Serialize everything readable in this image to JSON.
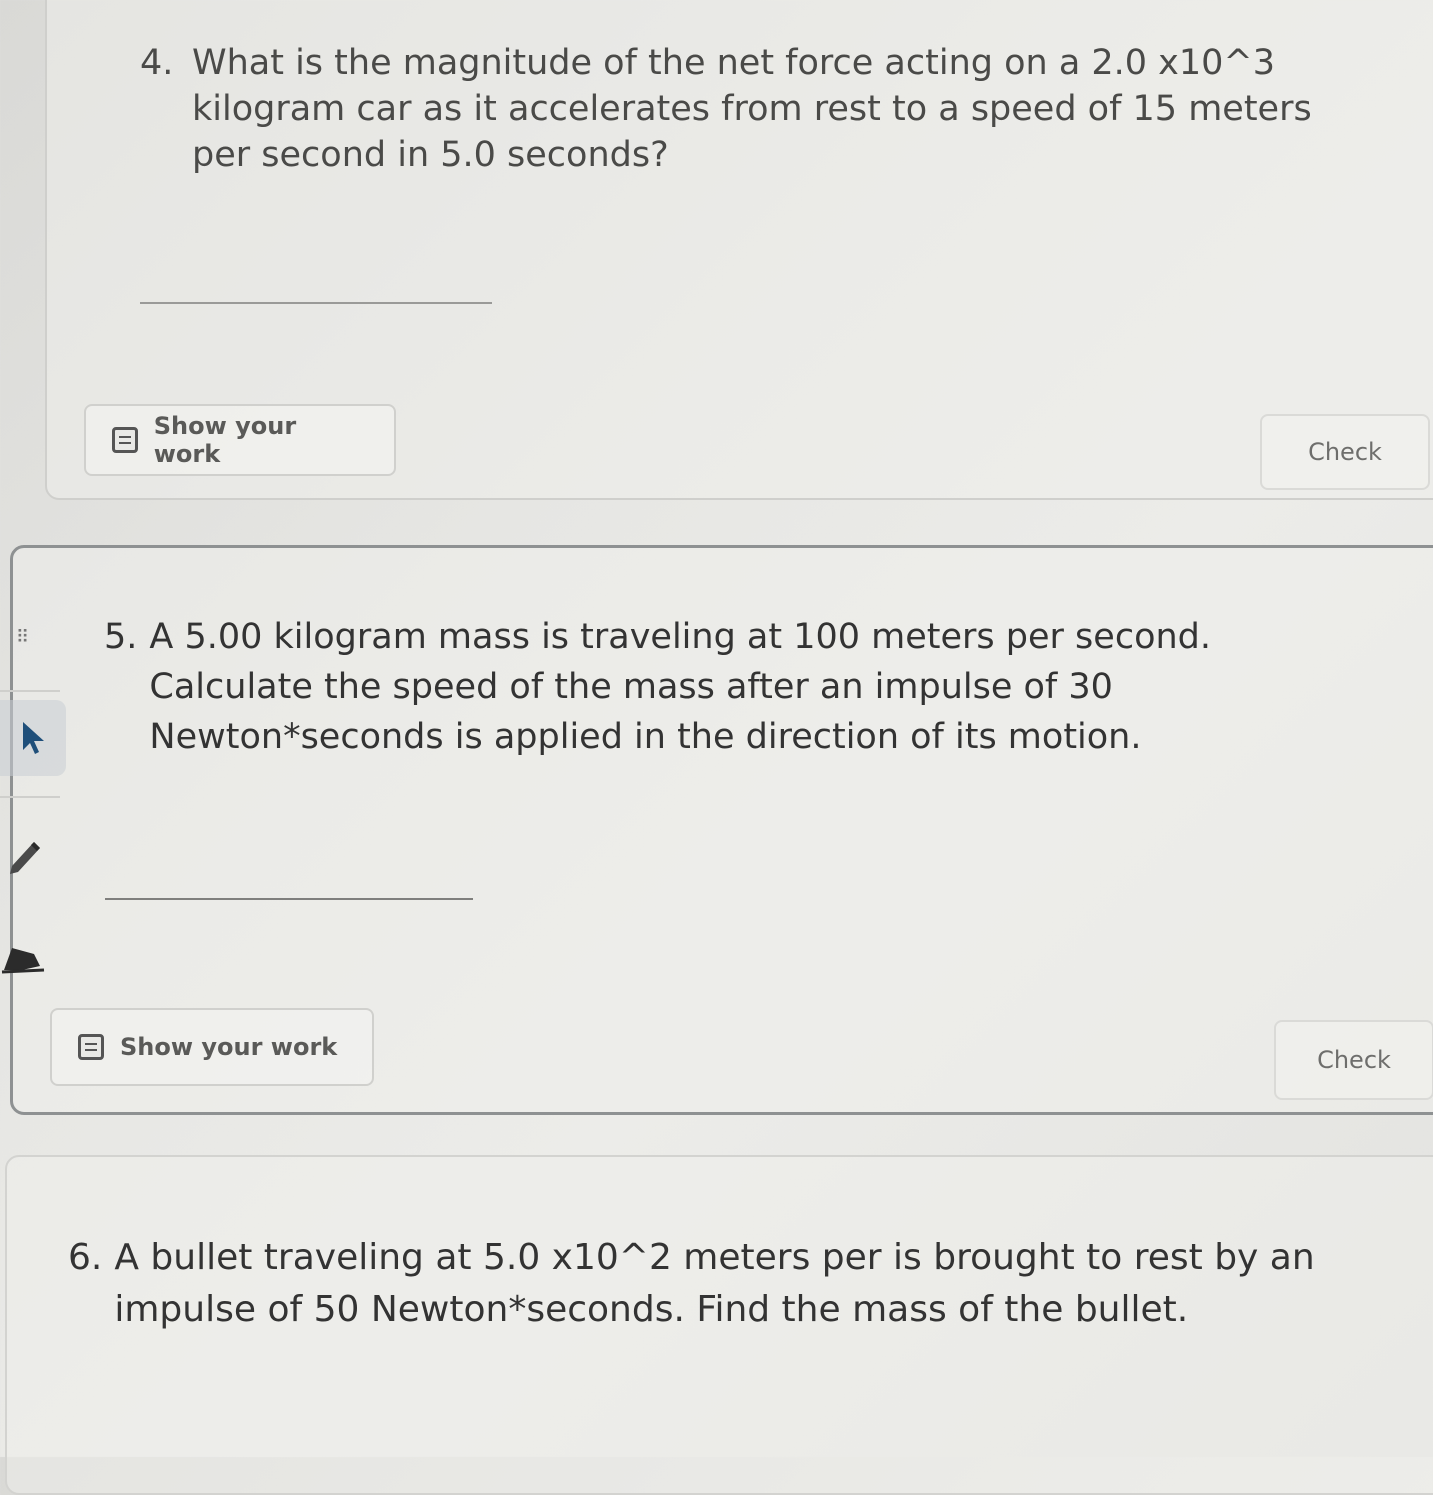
{
  "questions": [
    {
      "number": "4.",
      "text": "What is the magnitude of the net force acting on a 2.0 x10^3 kilogram car as it accelerates from rest to a speed of 15 meters per second in 5.0 seconds?",
      "answer": "",
      "show_work_label": "Show your work",
      "check_label": "Check"
    },
    {
      "number": "5.",
      "text": "A 5.00 kilogram mass is traveling at 100 meters per second. Calculate the speed of the mass after an impulse of 30 Newton*seconds is applied in the direction of its motion.",
      "answer": "",
      "show_work_label": "Show your work",
      "check_label": "Check"
    },
    {
      "number": "6.",
      "text": "A bullet traveling at 5.0 x10^2 meters per is brought to rest by an impulse of 50 Newton*seconds. Find the mass of the bullet."
    }
  ],
  "toolbar": {
    "grip_glyph": "⠿",
    "tools": [
      "drag-handle-icon",
      "pointer-icon",
      "pen-icon",
      "highlighter-icon"
    ]
  },
  "colors": {
    "card_active_border": "#8e9192",
    "text": "#333333",
    "button_text": "#5a5a58"
  }
}
